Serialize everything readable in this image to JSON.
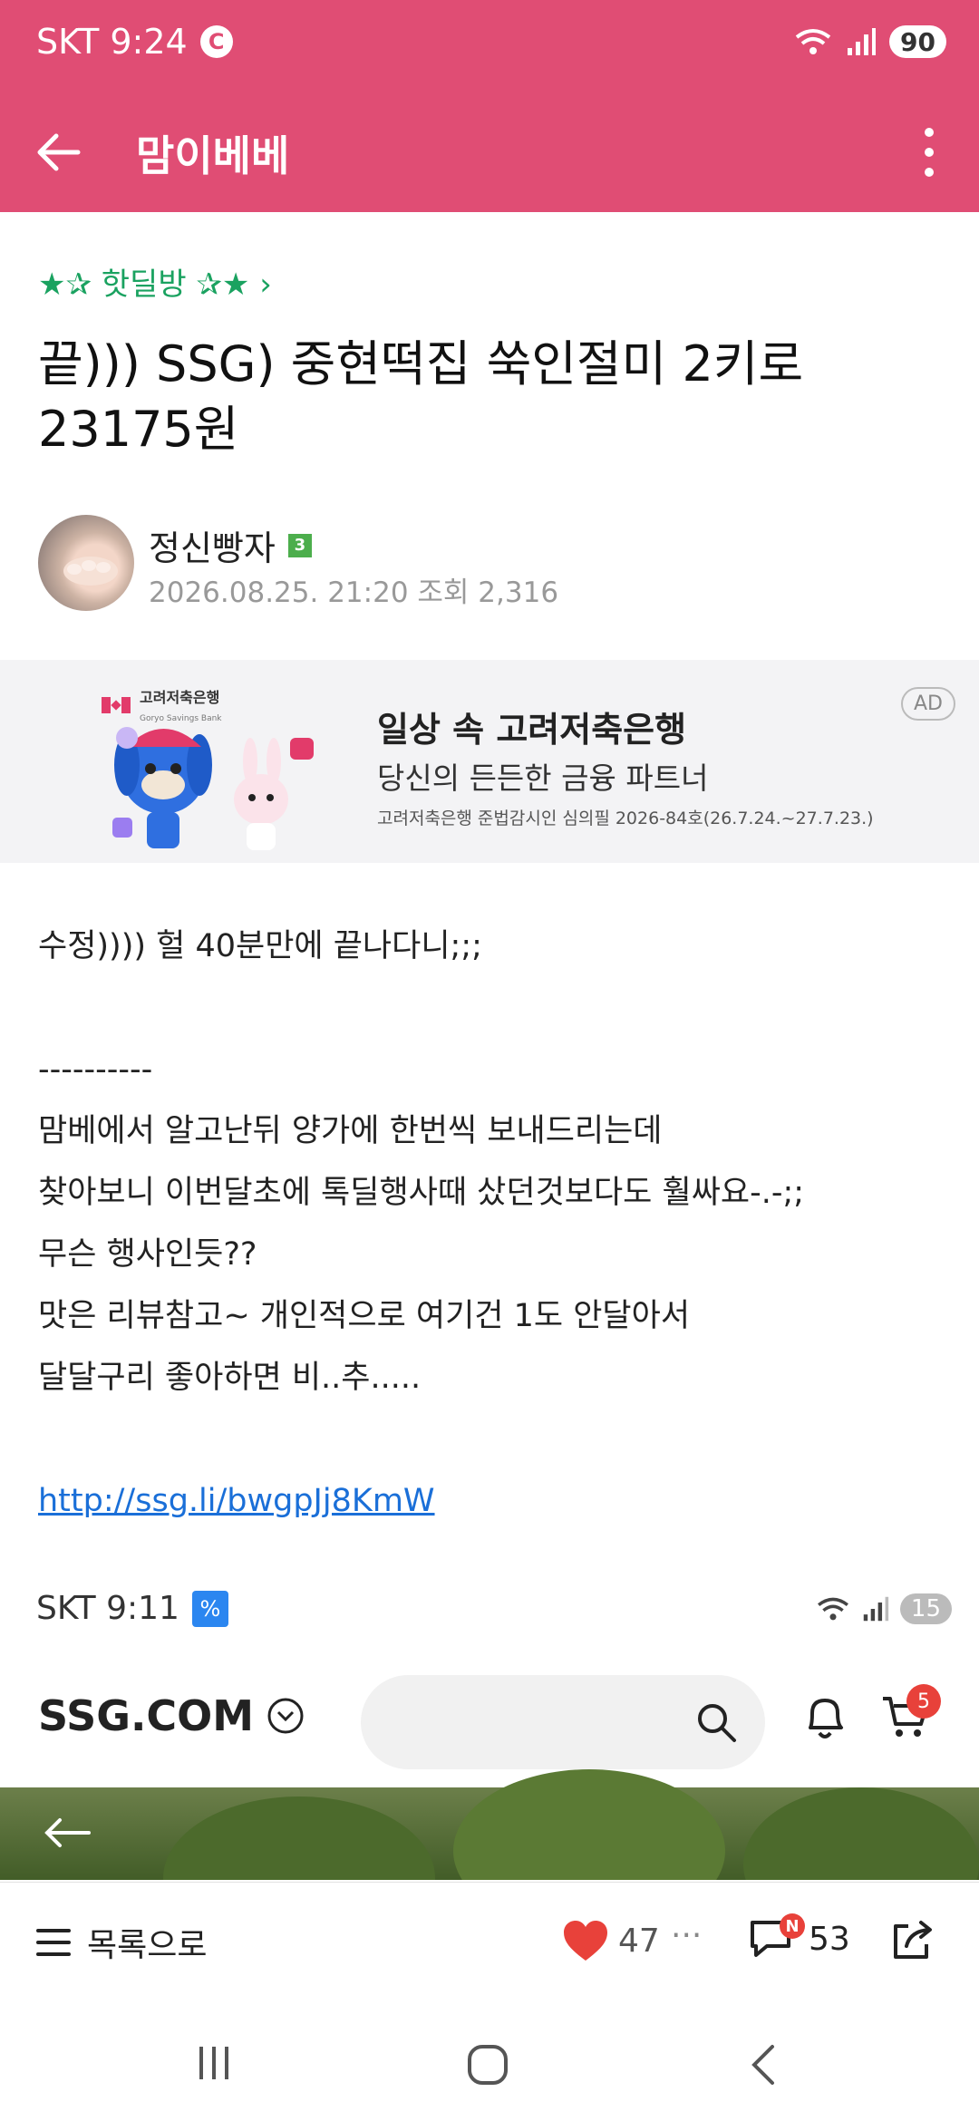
{
  "status_bar": {
    "carrier_time": "SKT 9:24",
    "carrier_badge": "C",
    "battery": "90"
  },
  "app_bar": {
    "title": "맘이베베"
  },
  "post": {
    "category": "★✰ 핫딜방 ✰★ ›",
    "title": "끝))) SSG) 중현떡집 쑥인절미 2키로 23175원",
    "author": "정신빵자",
    "author_level": "3",
    "date": "2026.08.25. 21:20",
    "views": "조회 2,316"
  },
  "ad": {
    "tag": "AD",
    "bank_name": "고려저축은행",
    "bank_name_en": "Goryo Savings Bank",
    "title": "일상 속 고려저축은행",
    "subtitle": "당신의 든든한 금융 파트너",
    "fineprint": "고려저축은행 준법감시인 심의필 2026-84호(26.7.24.~27.7.23.)"
  },
  "body": {
    "lines": [
      "수정)))) 헐 40분만에 끝나다니;;;",
      "",
      "----------",
      "맘베에서 알고난뒤 양가에 한번씩 보내드리는데",
      "찾아보니 이번달초에 톡딜행사때 샀던것보다도 훨싸요-.-;;",
      "무슨 행사인듯??",
      "맛은 리뷰참고~ 개인적으로 여기건 1도 안달아서",
      "달달구리 좋아하면 비..추.....",
      ""
    ],
    "link": "http://ssg.li/bwgpJj8KmW"
  },
  "embedded": {
    "carrier_time": "SKT 9:11",
    "carrier_badge": "%",
    "battery": "15",
    "logo": "SSG.COM",
    "cart_count": "5"
  },
  "actions": {
    "list_label": "목록으로",
    "likes": "47",
    "more": "···",
    "comments": "53",
    "new_badge": "N"
  }
}
